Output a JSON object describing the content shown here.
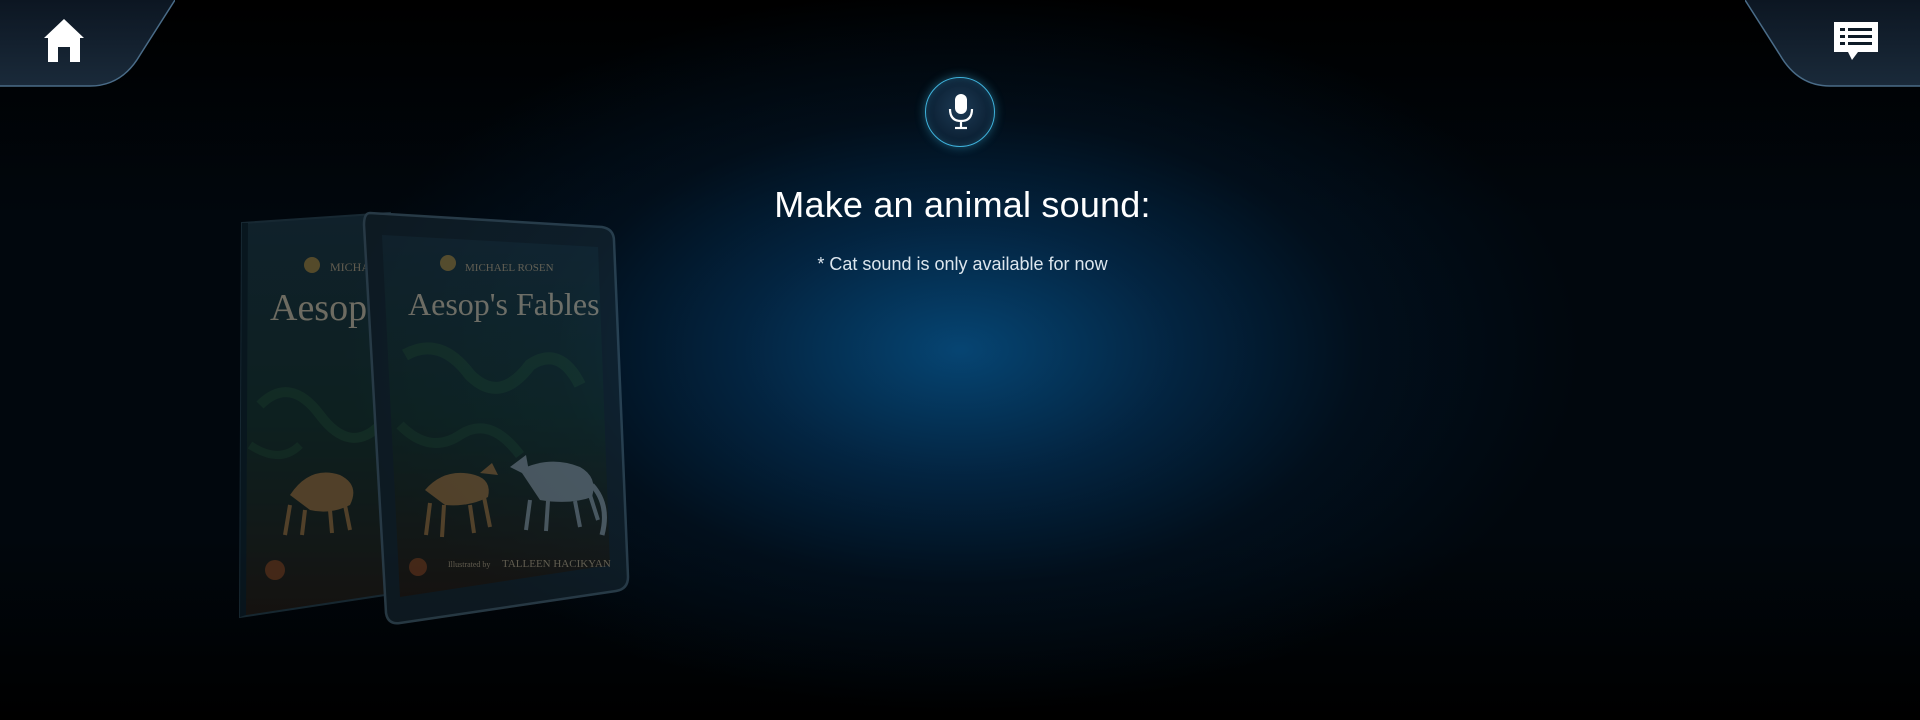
{
  "nav": {
    "home_icon": "home-icon",
    "chat_icon": "chat-icon"
  },
  "voice": {
    "mic_icon": "microphone-icon",
    "accent_color": "#3fb3dd"
  },
  "prompt": {
    "title": "Make an animal sound:",
    "note": "* Cat sound is only available for now"
  },
  "book": {
    "author": "MICHAEL ROSEN",
    "title": "Aesop's Fables",
    "illustrator_line": "Illustrated by TALLEEN HACIKYAN"
  }
}
